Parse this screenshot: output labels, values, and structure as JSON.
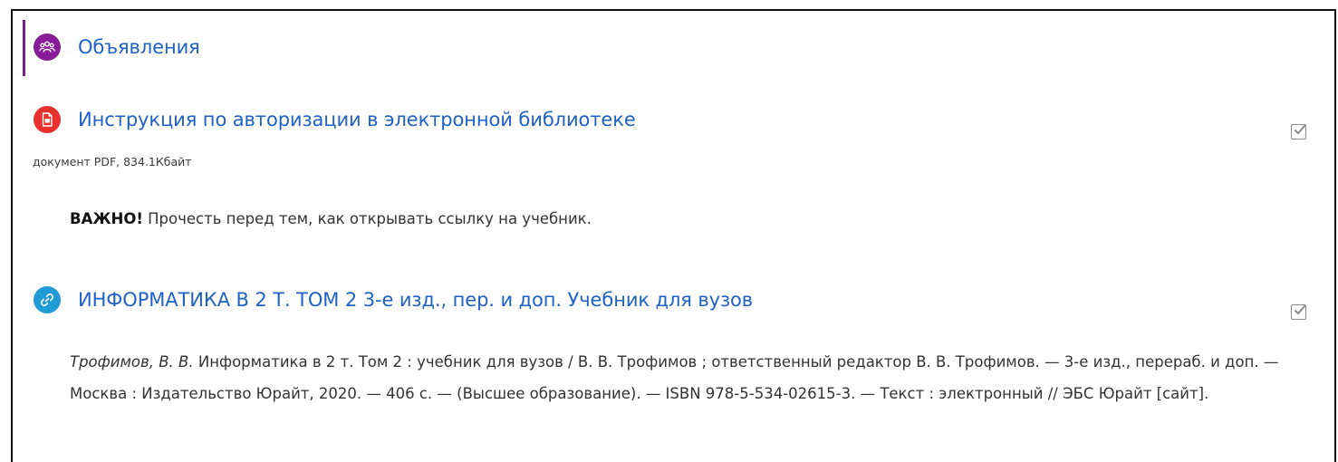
{
  "section": {
    "title": "Объявления",
    "icon": "forum-icon",
    "icon_color": "#8a1c9a",
    "accent_color": "#7a1f8c"
  },
  "resources": [
    {
      "title": "Инструкция по авторизации в электронной библиотеке",
      "icon": "pdf-icon",
      "icon_color": "#e8302e",
      "meta": "документ PDF, 834.1Кбайт",
      "note_bold": "ВАЖНО!",
      "note_text": " Прочесть перед тем, как открывать ссылку на учебник.",
      "completed": true
    },
    {
      "title": "ИНФОРМАТИКА В 2 Т. ТОМ 2 3-е изд., пер. и доп. Учебник для вузов",
      "icon": "link-icon",
      "icon_color": "#1f9bd6",
      "citation_author": "Трофимов, В. В.",
      "citation_text": " Информатика в 2 т. Том 2 : учебник для вузов / В. В. Трофимов ; ответственный редактор В. В. Трофимов. — 3-е изд., перераб. и доп. — Москва : Издательство Юрайт, 2020. — 406 с. — (Высшее образование). — ISBN 978-5-534-02615-3. — Текст : электронный // ЭБС Юрайт [сайт].",
      "completed": true
    }
  ],
  "colors": {
    "link": "#1f62c6",
    "text": "#333333"
  }
}
